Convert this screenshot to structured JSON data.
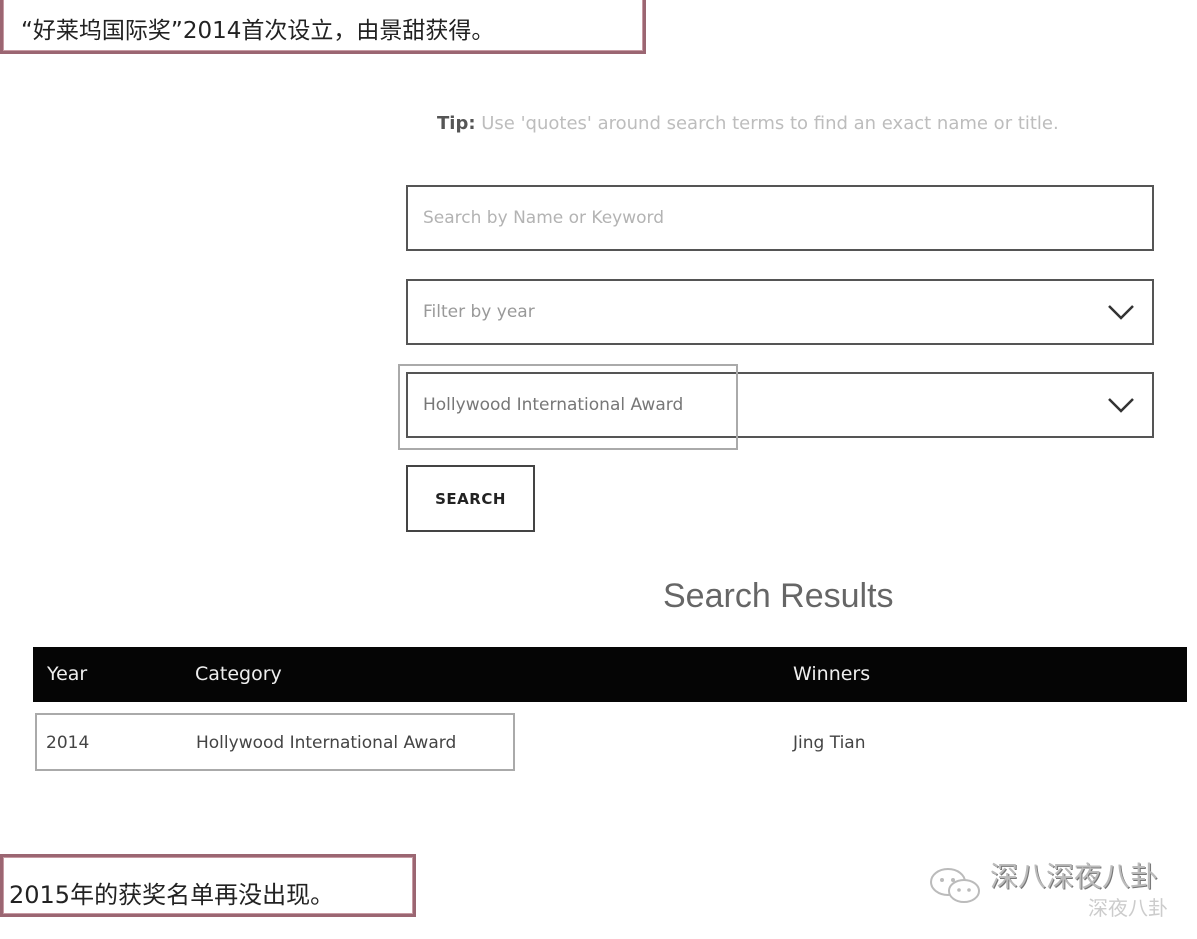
{
  "captions": {
    "top": "“好莱坞国际奖”2014首次设立，由景甜获得。",
    "bottom": "2015年的获奖名单再没出现。"
  },
  "search": {
    "tip_label": "Tip:",
    "tip_text": " Use 'quotes' around search terms to find an exact name or title.",
    "placeholder": "Search by Name or Keyword",
    "value": ""
  },
  "filters": {
    "year": {
      "value": "Filter by year",
      "icon": "chevron-down-icon"
    },
    "category": {
      "value": "Hollywood International Award",
      "icon": "chevron-down-icon"
    }
  },
  "search_button": {
    "label": "SEARCH"
  },
  "results": {
    "title": "Search Results",
    "columns": [
      "Year",
      "Category",
      "Winners"
    ],
    "rows": [
      {
        "year": "2014",
        "category": "Hollywood International Award",
        "winners": "Jing Tian"
      }
    ]
  },
  "watermark": {
    "title": "深八深夜八卦",
    "subtitle": "深夜八卦"
  },
  "colors": {
    "caption_border": "#9b6672",
    "table_header_bg": "#050505",
    "table_header_text": "#eeeeee"
  }
}
